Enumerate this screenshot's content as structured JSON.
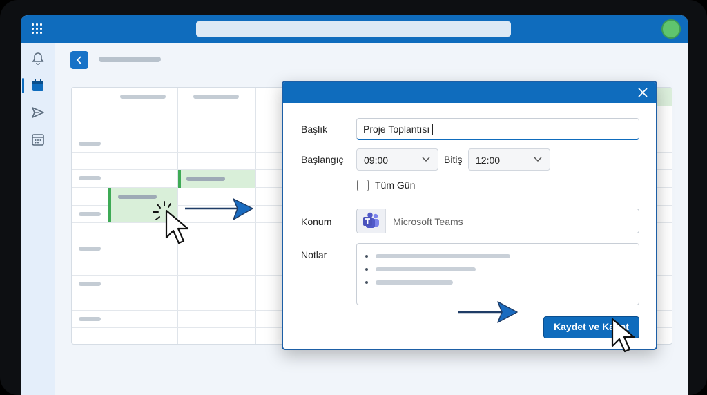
{
  "dialog": {
    "title_label": "Başlık",
    "title_value": "Proje Toplantısı",
    "start_label": "Başlangıç",
    "start_value": "09:00",
    "end_label": "Bitiş",
    "end_value": "12:00",
    "all_day_label": "Tüm Gün",
    "all_day_checked": false,
    "location_label": "Konum",
    "location_value": "Microsoft Teams",
    "notes_label": "Notlar",
    "save_label": "Kaydet ve Kapat"
  },
  "icons": {
    "app_launcher": "grid-icon",
    "notifications": "bell-icon",
    "calendar": "calendar-icon",
    "send": "send-icon",
    "calendar_alt": "calendar-grid-icon",
    "back": "chevron-left-icon",
    "close": "close-icon",
    "teams": "teams-icon"
  },
  "colors": {
    "brand": "#0f6cbd",
    "event_fill": "#d9efd9",
    "event_accent": "#3eaa55",
    "avatar": "#5fc46e"
  }
}
